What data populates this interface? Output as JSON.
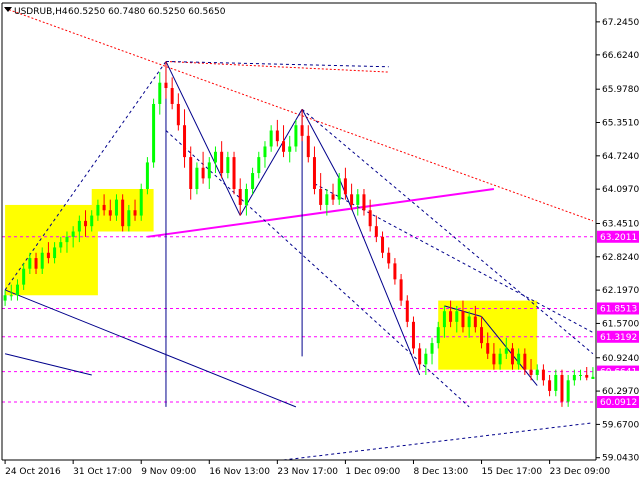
{
  "chart_data": {
    "type": "candlestick",
    "title": "USDRUB,H4",
    "title_values": "60.5250 60.7480 60.5250 60.5650",
    "ylim": [
      59.0,
      67.6
    ],
    "y_ticks": [
      67.245,
      66.624,
      65.978,
      65.351,
      64.724,
      64.097,
      63.451,
      62.824,
      62.197,
      61.57,
      60.924,
      60.297,
      59.67,
      59.043
    ],
    "x_tick_labels": [
      "24 Oct 2016",
      "31 Oct 17:00",
      "9 Nov 09:00",
      "16 Nov 13:00",
      "23 Nov 17:00",
      "1 Dec 09:00",
      "8 Dec 13:00",
      "15 Dec 17:00",
      "23 Dec 09:00"
    ],
    "x_ticks": [
      0,
      11,
      22,
      33,
      44,
      55,
      66,
      77,
      88
    ],
    "n_bars": 96,
    "price_levels": [
      {
        "value": 63.2011,
        "label": "63.2011",
        "color": "#ff00ff"
      },
      {
        "value": 61.8513,
        "label": "61.8513",
        "color": "#ff00ff"
      },
      {
        "value": 61.3192,
        "label": "61.3192",
        "color": "#ff00ff"
      },
      {
        "value": 60.6641,
        "label": "60.6641",
        "color": "#ff00ff"
      },
      {
        "value": 60.0912,
        "label": "60.0912",
        "color": "#ff00ff"
      }
    ],
    "current_price": {
      "value": 60.565,
      "label": "60.5650",
      "color": "#ffffff"
    },
    "bull_color": "#00ff00",
    "bear_color": "#ff0000",
    "rect_color": "#ffff00",
    "channel_color": "#00008b",
    "trend_color": "#ff00ff",
    "resistance_color": "#ff0000",
    "rectangles": [
      {
        "x0": 0,
        "x1": 15,
        "y0": 63.8,
        "y1": 62.1
      },
      {
        "x0": 14,
        "x1": 24,
        "y0": 64.1,
        "y1": 63.3
      },
      {
        "x0": 70,
        "x1": 86,
        "y0": 62.0,
        "y1": 60.7
      }
    ],
    "candles": [
      [
        62.0,
        62.2,
        61.9,
        62.1
      ],
      [
        62.1,
        62.3,
        62.0,
        62.1
      ],
      [
        62.1,
        62.4,
        62.0,
        62.3
      ],
      [
        62.3,
        62.7,
        62.2,
        62.6
      ],
      [
        62.6,
        62.9,
        62.5,
        62.8
      ],
      [
        62.8,
        62.9,
        62.5,
        62.6
      ],
      [
        62.6,
        63.0,
        62.5,
        62.9
      ],
      [
        62.9,
        63.1,
        62.7,
        62.8
      ],
      [
        62.8,
        63.1,
        62.7,
        63.0
      ],
      [
        63.0,
        63.2,
        62.9,
        63.1
      ],
      [
        63.1,
        63.3,
        62.9,
        63.2
      ],
      [
        63.2,
        63.4,
        63.0,
        63.3
      ],
      [
        63.3,
        63.6,
        63.1,
        63.5
      ],
      [
        63.5,
        63.7,
        63.2,
        63.4
      ],
      [
        63.4,
        63.7,
        63.3,
        63.6
      ],
      [
        63.6,
        63.9,
        63.5,
        63.8
      ],
      [
        63.8,
        64.0,
        63.6,
        63.7
      ],
      [
        63.7,
        63.9,
        63.5,
        63.6
      ],
      [
        63.6,
        64.0,
        63.5,
        63.9
      ],
      [
        63.9,
        64.0,
        63.3,
        63.4
      ],
      [
        63.4,
        63.8,
        63.3,
        63.7
      ],
      [
        63.7,
        63.9,
        63.5,
        63.6
      ],
      [
        63.6,
        64.2,
        63.5,
        64.1
      ],
      [
        64.1,
        64.7,
        64.0,
        64.6
      ],
      [
        64.6,
        65.8,
        64.5,
        65.7
      ],
      [
        65.7,
        66.3,
        65.5,
        66.1
      ],
      [
        66.1,
        66.5,
        65.8,
        66.0
      ],
      [
        66.0,
        66.2,
        65.6,
        65.7
      ],
      [
        65.7,
        65.9,
        65.2,
        65.3
      ],
      [
        65.3,
        65.6,
        64.5,
        64.7
      ],
      [
        64.7,
        64.9,
        63.9,
        64.1
      ],
      [
        64.1,
        64.6,
        64.0,
        64.5
      ],
      [
        64.5,
        64.8,
        64.2,
        64.3
      ],
      [
        64.3,
        64.7,
        64.1,
        64.6
      ],
      [
        64.6,
        64.9,
        64.4,
        64.8
      ],
      [
        64.8,
        65.0,
        64.3,
        64.4
      ],
      [
        64.4,
        64.8,
        64.3,
        64.7
      ],
      [
        64.7,
        64.8,
        64.0,
        64.1
      ],
      [
        64.1,
        64.3,
        63.6,
        63.8
      ],
      [
        63.8,
        64.2,
        63.6,
        64.1
      ],
      [
        64.1,
        64.5,
        64.0,
        64.4
      ],
      [
        64.4,
        64.8,
        64.3,
        64.7
      ],
      [
        64.7,
        65.0,
        64.5,
        64.9
      ],
      [
        64.9,
        65.3,
        64.8,
        65.2
      ],
      [
        65.2,
        65.4,
        64.9,
        65.0
      ],
      [
        65.0,
        65.3,
        64.7,
        64.8
      ],
      [
        64.8,
        65.1,
        64.6,
        64.9
      ],
      [
        64.9,
        65.4,
        64.8,
        65.3
      ],
      [
        65.3,
        65.6,
        65.0,
        65.1
      ],
      [
        65.1,
        65.3,
        64.6,
        64.7
      ],
      [
        64.7,
        64.9,
        64.0,
        64.1
      ],
      [
        64.1,
        64.4,
        63.7,
        63.8
      ],
      [
        63.8,
        64.1,
        63.6,
        64.0
      ],
      [
        64.0,
        64.2,
        63.8,
        63.9
      ],
      [
        63.9,
        64.4,
        63.8,
        64.3
      ],
      [
        64.3,
        64.5,
        63.9,
        64.0
      ],
      [
        64.0,
        64.2,
        63.7,
        63.8
      ],
      [
        63.8,
        64.1,
        63.6,
        64.0
      ],
      [
        64.0,
        64.1,
        63.6,
        63.7
      ],
      [
        63.7,
        63.9,
        63.3,
        63.4
      ],
      [
        63.4,
        63.6,
        63.1,
        63.2
      ],
      [
        63.2,
        63.3,
        62.8,
        62.9
      ],
      [
        62.9,
        63.0,
        62.6,
        62.7
      ],
      [
        62.7,
        62.8,
        62.3,
        62.4
      ],
      [
        62.4,
        62.5,
        61.9,
        62.0
      ],
      [
        62.0,
        62.1,
        61.5,
        61.6
      ],
      [
        61.6,
        61.7,
        61.0,
        61.1
      ],
      [
        61.1,
        61.2,
        60.7,
        60.8
      ],
      [
        60.8,
        61.1,
        60.6,
        61.0
      ],
      [
        61.0,
        61.3,
        60.8,
        61.2
      ],
      [
        61.2,
        61.6,
        61.1,
        61.5
      ],
      [
        61.5,
        61.9,
        61.3,
        61.8
      ],
      [
        61.8,
        62.0,
        61.5,
        61.6
      ],
      [
        61.6,
        61.9,
        61.4,
        61.8
      ],
      [
        61.8,
        62.0,
        61.4,
        61.5
      ],
      [
        61.5,
        61.8,
        61.3,
        61.7
      ],
      [
        61.7,
        61.9,
        61.4,
        61.5
      ],
      [
        61.5,
        61.7,
        61.1,
        61.2
      ],
      [
        61.2,
        61.4,
        60.9,
        61.0
      ],
      [
        61.0,
        61.2,
        60.7,
        60.8
      ],
      [
        60.8,
        61.1,
        60.7,
        61.0
      ],
      [
        61.0,
        61.3,
        60.9,
        61.1
      ],
      [
        61.1,
        61.2,
        60.7,
        60.8
      ],
      [
        60.8,
        61.1,
        60.7,
        61.0
      ],
      [
        61.0,
        61.1,
        60.6,
        60.7
      ],
      [
        60.7,
        60.9,
        60.5,
        60.6
      ],
      [
        60.6,
        60.8,
        60.5,
        60.7
      ],
      [
        60.7,
        60.8,
        60.4,
        60.5
      ],
      [
        60.5,
        60.6,
        60.2,
        60.3
      ],
      [
        60.3,
        60.7,
        60.2,
        60.6
      ],
      [
        60.6,
        60.7,
        60.0,
        60.1
      ],
      [
        60.1,
        60.6,
        60.0,
        60.5
      ],
      [
        60.5,
        60.7,
        60.4,
        60.6
      ],
      [
        60.6,
        60.7,
        60.5,
        60.6
      ],
      [
        60.6,
        60.75,
        60.5,
        60.55
      ],
      [
        60.525,
        60.748,
        60.525,
        60.565
      ]
    ]
  }
}
